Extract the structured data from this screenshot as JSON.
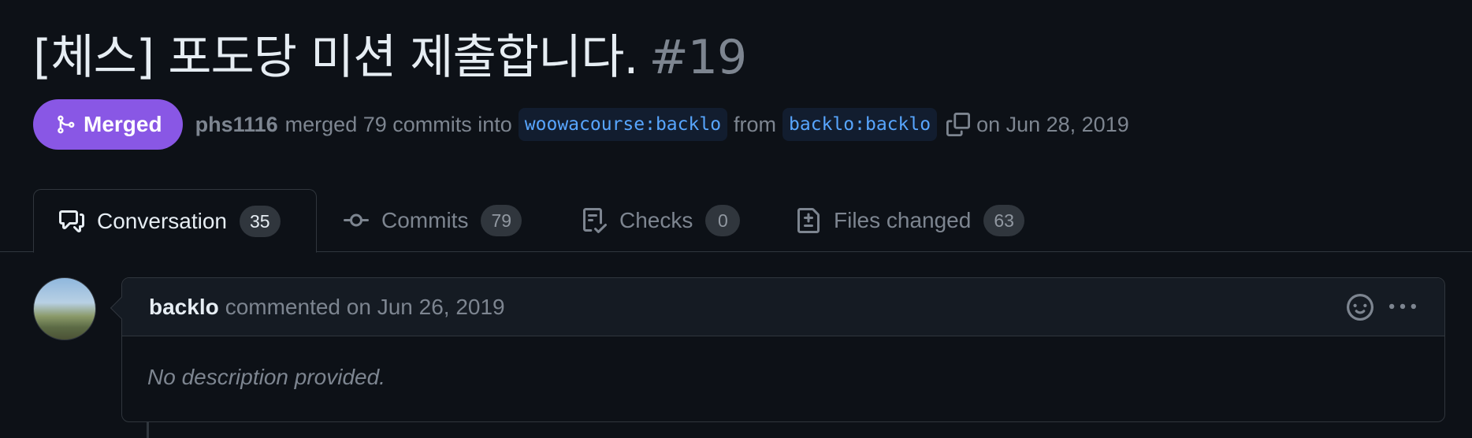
{
  "pr": {
    "title": "[체스] 포도당 미션 제출합니다.",
    "number": "#19"
  },
  "status": {
    "label": "Merged",
    "color": "#8957e5"
  },
  "meta": {
    "author": "phs1116",
    "text_merged": "merged 79 commits into",
    "base_branch": "woowacourse:backlo",
    "text_from": "from",
    "head_branch": "backlo:backlo",
    "date_text": "on Jun 28, 2019"
  },
  "tabs": [
    {
      "label": "Conversation",
      "count": "35",
      "icon": "comment-discussion-icon"
    },
    {
      "label": "Commits",
      "count": "79",
      "icon": "git-commit-icon"
    },
    {
      "label": "Checks",
      "count": "0",
      "icon": "checklist-icon"
    },
    {
      "label": "Files changed",
      "count": "63",
      "icon": "file-diff-icon"
    }
  ],
  "comment": {
    "author": "backlo",
    "date_text": "commented on Jun 26, 2019",
    "body": "No description provided."
  }
}
